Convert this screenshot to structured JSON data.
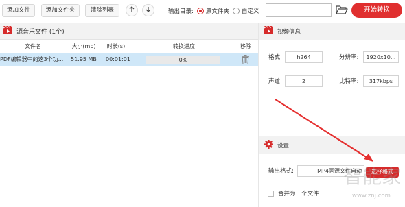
{
  "toolbar": {
    "add_file": "添加文件",
    "add_folder": "添加文件夹",
    "clear_list": "清除列表",
    "output_dir_label": "输出目录:",
    "radio_source": "原文件夹",
    "radio_custom": "自定义",
    "output_path": "",
    "start_button": "开始转换"
  },
  "file_list": {
    "title": "源音乐文件 (1个)",
    "columns": {
      "filename": "文件名",
      "size": "大小(mb)",
      "duration": "时长(s)",
      "progress": "转换进度",
      "remove": "移除"
    },
    "rows": [
      {
        "filename": "PDF编辑器中的这3个功...",
        "size": "51.95 MB",
        "duration": "00:01:01",
        "progress_text": "0%",
        "progress_value": 0
      }
    ]
  },
  "video_info": {
    "title": "视频信息",
    "format_label": "格式:",
    "format_value": "h264",
    "resolution_label": "分辨率:",
    "resolution_value": "1920x10...",
    "channels_label": "声道:",
    "channels_value": "2",
    "bitrate_label": "比特率:",
    "bitrate_value": "317kbps"
  },
  "settings": {
    "title": "设置",
    "output_format_label": "输出格式:",
    "output_format_value": "MP4同源文件自动",
    "choose_format_button": "选择格式",
    "merge_label": "合并为一个文件"
  },
  "watermark": {
    "logo": "智能家",
    "url": "www.znj.com"
  },
  "colors": {
    "accent": "#e02f2f",
    "row_selected": "#cfe7f8"
  }
}
